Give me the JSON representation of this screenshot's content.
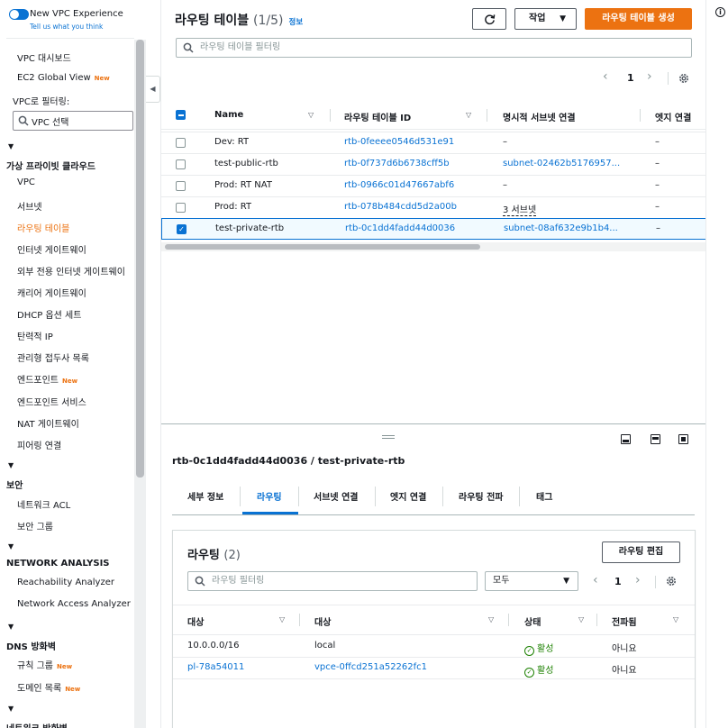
{
  "sidebar": {
    "experience_title": "New VPC Experience",
    "experience_sub": "Tell us what you think",
    "dashboard": "VPC 대시보드",
    "ec2_global": "EC2 Global View",
    "new_badge": "New",
    "filter_label": "VPC로 필터링:",
    "vpc_select": "VPC 선택",
    "sec_private": "가상 프라이빗 클라우드",
    "items_private": [
      "VPC",
      "서브넷",
      "라우팅 테이블",
      "인터넷 게이트웨이",
      "외부 전용 인터넷 게이트웨이",
      "캐리어 게이트웨이",
      "DHCP 옵션 세트",
      "탄력적 IP",
      "관리형 접두사 목록",
      "엔드포인트",
      "엔드포인트 서비스",
      "NAT 게이트웨이",
      "피어링 연결"
    ],
    "sec_security": "보안",
    "items_security": [
      "네트워크 ACL",
      "보안 그룹"
    ],
    "sec_network": "NETWORK ANALYSIS",
    "items_network": [
      "Reachability Analyzer",
      "Network Access Analyzer"
    ],
    "sec_dns": "DNS 방화벽",
    "items_dns": [
      "규칙 그룹",
      "도메인 목록"
    ],
    "sec_netfw": "네트워크 방화벽"
  },
  "header": {
    "title": "라우팅 테이블",
    "count": "(1/5)",
    "info": "정보",
    "actions_label": "작업",
    "create_label": "라우팅 테이블 생성",
    "search_placeholder": "라우팅 테이블 필터링",
    "page": "1"
  },
  "table": {
    "columns": [
      "Name",
      "라우팅 테이블 ID",
      "명시적 서브넷 연결",
      "엣지 연결"
    ],
    "rows": [
      {
        "name": "Dev: RT",
        "id": "rtb-0feeee0546d531e91",
        "subnet": "–",
        "edge": "–"
      },
      {
        "name": "test-public-rtb",
        "id": "rtb-0f737d6b6738cff5b",
        "subnet": "subnet-02462b5176957...",
        "edge": "–"
      },
      {
        "name": "Prod: RT NAT",
        "id": "rtb-0966c01d47667abf6",
        "subnet": "–",
        "edge": "–"
      },
      {
        "name": "Prod: RT",
        "id": "rtb-078b484cdd5d2a00b",
        "subnet": "3 서브넷",
        "edge": "–"
      },
      {
        "name": "test-private-rtb",
        "id": "rtb-0c1dd4fadd44d0036",
        "subnet": "subnet-08af632e9b1b4...",
        "edge": "–"
      }
    ]
  },
  "detail": {
    "title": "rtb-0c1dd4fadd44d0036 / test-private-rtb",
    "tabs": [
      "세부 정보",
      "라우팅",
      "서브넷 연결",
      "엣지 연결",
      "라우팅 전파",
      "태그"
    ],
    "routes_title": "라우팅",
    "routes_count": "(2)",
    "edit_label": "라우팅 편집",
    "search_placeholder": "라우팅 필터링",
    "filter_select": "모두",
    "page": "1",
    "columns": [
      "대상",
      "대상",
      "상태",
      "전파됨"
    ],
    "rows": [
      {
        "dest": "10.0.0.0/16",
        "target": "local",
        "status": "활성",
        "propagated": "아니요"
      },
      {
        "dest": "pl-78a54011",
        "target": "vpce-0ffcd251a52262fc1",
        "status": "활성",
        "propagated": "아니요"
      }
    ]
  },
  "colors": {
    "accent": "#0972d3",
    "primary": "#ec7211",
    "success": "#1d8102"
  }
}
